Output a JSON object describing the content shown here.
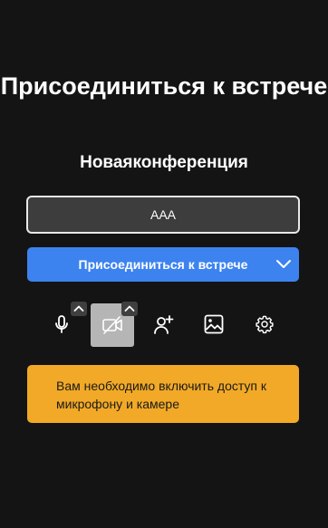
{
  "page": {
    "title": "Присоединиться к встрече",
    "room_name": "Новаяконференция"
  },
  "name_input": {
    "value": "AAA"
  },
  "join_button": {
    "label": "Присоединиться к встрече",
    "icon": "chevron-down-icon"
  },
  "toolbar": {
    "items": [
      {
        "name": "microphone",
        "icon": "microphone-icon"
      },
      {
        "name": "camera",
        "icon": "camera-off-icon",
        "state": "disabled"
      },
      {
        "name": "invite",
        "icon": "add-person-icon"
      },
      {
        "name": "background",
        "icon": "image-icon"
      },
      {
        "name": "settings",
        "icon": "gear-icon"
      }
    ]
  },
  "warning": {
    "text": "Вам необходимо включить доступ к микрофону и камере"
  },
  "colors": {
    "background": "#141414",
    "input_bg": "#3d3d3d",
    "join_button": "#3d83ef",
    "warning_bg": "#f2a927"
  }
}
